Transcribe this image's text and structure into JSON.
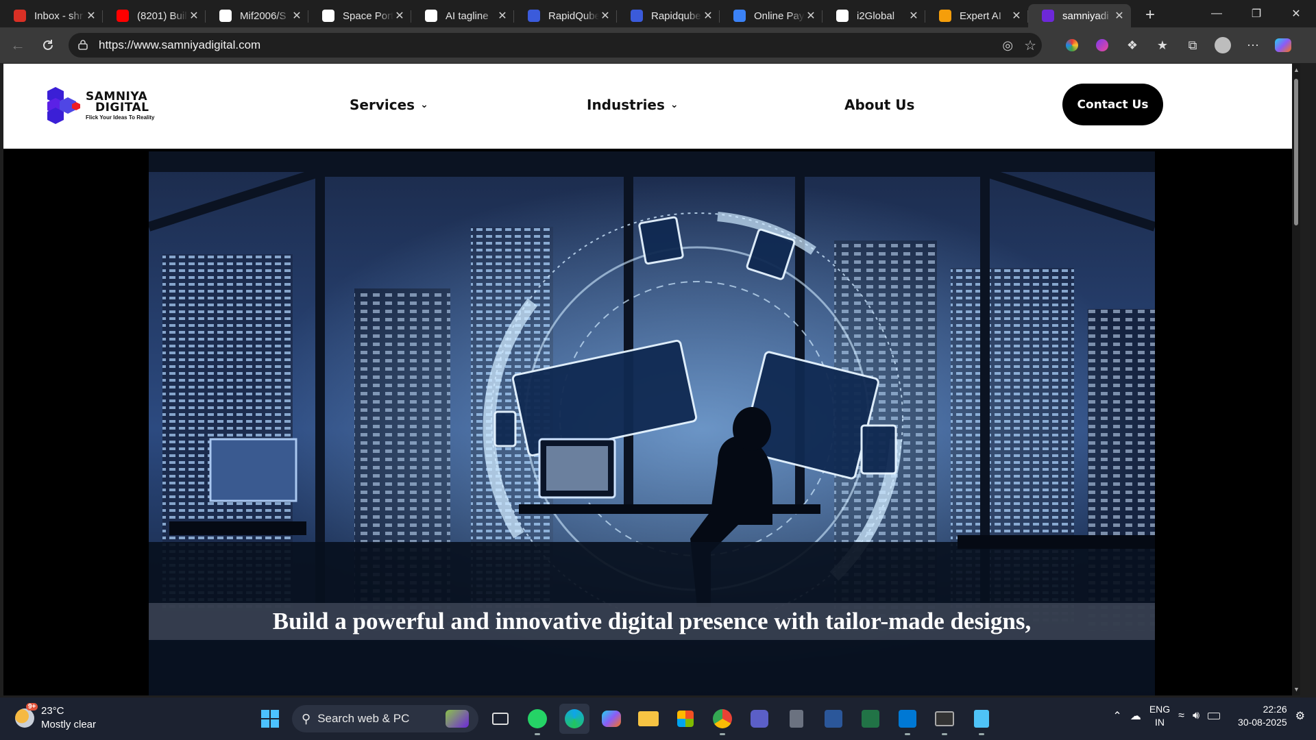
{
  "browser": {
    "tabs": [
      {
        "label": "Inbox - shr",
        "icon": "gmail-icon",
        "color": "#d93025"
      },
      {
        "label": "(8201) Buil",
        "icon": "youtube-icon",
        "color": "#ff0000"
      },
      {
        "label": "Mif2006/S",
        "icon": "github-icon",
        "color": "#ffffff"
      },
      {
        "label": "Space Port",
        "icon": "triangle-logo-icon",
        "color": "#ffffff"
      },
      {
        "label": "AI tagline",
        "icon": "chatgpt-icon",
        "color": "#ffffff"
      },
      {
        "label": "RapidQube",
        "icon": "rapidqube-icon",
        "color": "#3b5bdb"
      },
      {
        "label": "Rapidqube",
        "icon": "rapidqube-icon",
        "color": "#3b5bdb"
      },
      {
        "label": "Online Pay",
        "icon": "loading-icon",
        "color": "#3b82f6"
      },
      {
        "label": "i2Global",
        "icon": "i2global-icon",
        "color": "#ffffff"
      },
      {
        "label": "Expert AI",
        "icon": "expert-ai-icon",
        "color": "#f59e0b"
      },
      {
        "label": "samniyadi",
        "icon": "samniya-icon",
        "color": "#6d28d9",
        "active": true
      }
    ],
    "url": "https://www.samniyadigital.com"
  },
  "site": {
    "logo": {
      "line1": "SAMNIYA",
      "line2": "DIGITAL",
      "tagline": "Flick Your Ideas To Reality"
    },
    "nav": {
      "services": "Services",
      "industries": "Industries",
      "about": "About Us"
    },
    "cta": "Contact Us",
    "hero_caption": "Build a powerful and innovative digital presence with tailor-made designs,"
  },
  "taskbar": {
    "weather": {
      "temp": "23°C",
      "condition": "Mostly clear",
      "badge": "9+"
    },
    "search_placeholder": "Search web & PC",
    "lang": {
      "line1": "ENG",
      "line2": "IN"
    },
    "time": "22:26",
    "date": "30-08-2025"
  }
}
